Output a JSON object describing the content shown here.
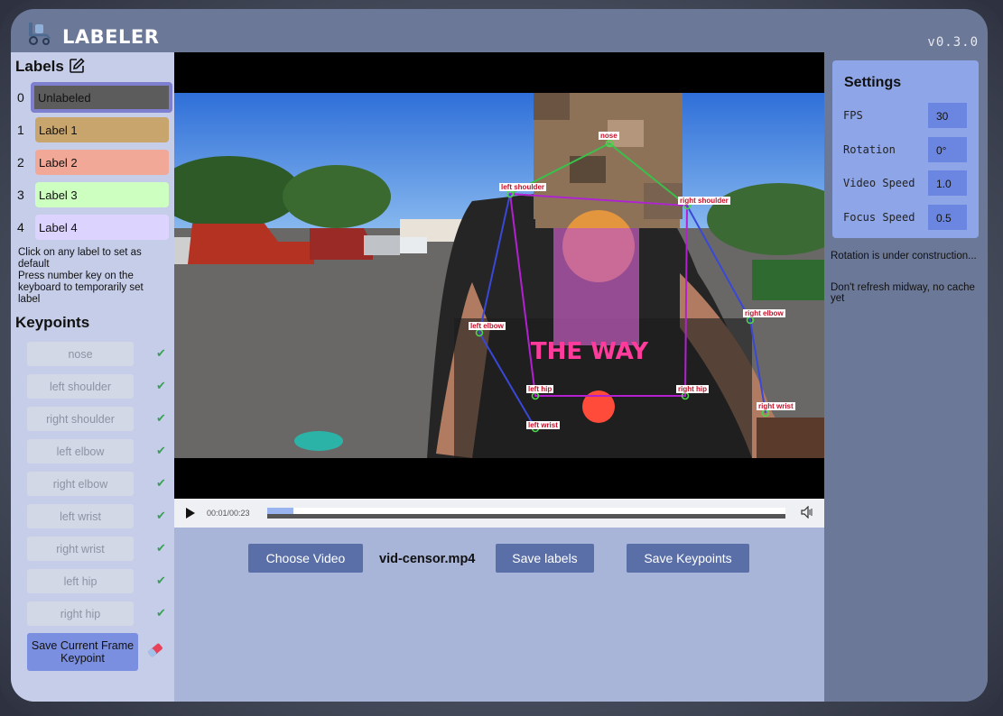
{
  "app": {
    "title": "LABELER",
    "version": "v0.3.0"
  },
  "labels": {
    "title": "Labels",
    "items": [
      {
        "num": "0",
        "label": "Unlabeled",
        "color": "#5c5c5c",
        "selected": true
      },
      {
        "num": "1",
        "label": "Label 1",
        "color": "#c8a56c"
      },
      {
        "num": "2",
        "label": "Label 2",
        "color": "#f2a897"
      },
      {
        "num": "3",
        "label": "Label 3",
        "color": "#ccffc0"
      },
      {
        "num": "4",
        "label": "Label 4",
        "color": "#dcd4ff"
      }
    ],
    "hint1": "Click on any label to set as default",
    "hint2": "Press number key on the keyboard to temporarily set label"
  },
  "keypoints": {
    "title": "Keypoints",
    "items": [
      "nose",
      "left shoulder",
      "right shoulder",
      "left elbow",
      "right elbow",
      "left wrist",
      "right wrist",
      "left hip",
      "right hip"
    ],
    "check": "✔",
    "save_label": "Save Current Frame Keypoint"
  },
  "video": {
    "time": "00:01/00:23",
    "progress": 0.05,
    "filename": "vid-censor.mp4",
    "overlay_labels": [
      "nose",
      "left shoulder",
      "right shoulder",
      "left elbow",
      "right elbow",
      "left wrist",
      "right wrist",
      "left hip",
      "right hip"
    ],
    "overlay_shirt_text": "THE WAY"
  },
  "buttons": {
    "choose_video": "Choose Video",
    "save_labels": "Save labels",
    "save_keypoints": "Save Keypoints"
  },
  "settings": {
    "title": "Settings",
    "rows": [
      {
        "label": "FPS",
        "value": "30"
      },
      {
        "label": "Rotation",
        "value": "0°"
      },
      {
        "label": "Video Speed",
        "value": "1.0"
      },
      {
        "label": "Focus Speed",
        "value": "0.5"
      }
    ],
    "note1": "Rotation is under construction...",
    "note2": "Don't refresh midway, no cache yet"
  }
}
